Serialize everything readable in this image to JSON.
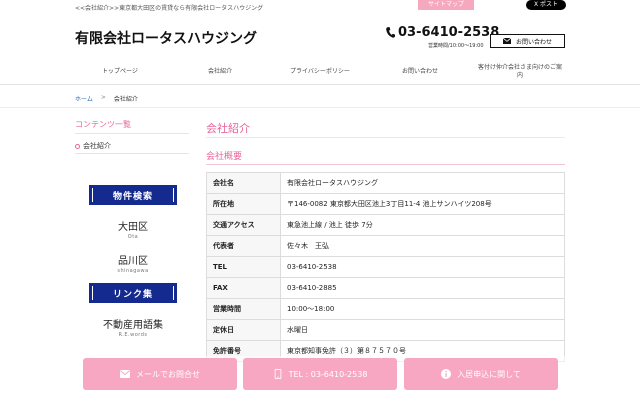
{
  "header": {
    "tagline": "<<会社紹介>>東京都大田区の賃貸なら有限会社ロータスハウジング",
    "sitemap_label": "サイトマップ",
    "x_post_label": "X ポスト",
    "company_name": "有限会社ロータスハウジング",
    "phone": "03-6410-2538",
    "hours": "営業時間/10:00〜19:00",
    "contact_label": "お問い合わせ"
  },
  "nav": {
    "items": [
      {
        "label": "トップページ"
      },
      {
        "label": "会社紹介"
      },
      {
        "label": "プライバシーポリシー"
      },
      {
        "label": "お問い合わせ"
      },
      {
        "label": "客付け仲介会社さま向けのご案内"
      }
    ]
  },
  "breadcrumb": {
    "home": "ホーム",
    "separator": ">",
    "current": "会社紹介"
  },
  "sidebar": {
    "title": "コンテンツ一覧",
    "item": "会社紹介",
    "property_search": "物件検索",
    "areas": [
      {
        "jp": "大田区",
        "en": "Ota"
      },
      {
        "jp": "品川区",
        "en": "shinagawa"
      }
    ],
    "links_title": "リンク集",
    "links": [
      {
        "jp": "不動産用語集",
        "en": "R.E.words"
      }
    ]
  },
  "main": {
    "title": "会社紹介",
    "subtitle": "会社概要",
    "rows": [
      {
        "key": "会社名",
        "value": "有限会社ロータスハウジング"
      },
      {
        "key": "所在地",
        "value": "〒146-0082 東京都大田区池上3丁目11-4 池上サンハイツ208号"
      },
      {
        "key": "交通アクセス",
        "value": "東急池上線 / 池上 徒歩 7分"
      },
      {
        "key": "代表者",
        "value": "佐々木　王弘"
      },
      {
        "key": "TEL",
        "value": "03-6410-2538"
      },
      {
        "key": "FAX",
        "value": "03-6410-2885"
      },
      {
        "key": "営業時間",
        "value": "10:00〜18:00"
      },
      {
        "key": "定休日",
        "value": "水曜日"
      },
      {
        "key": "免許番号",
        "value": "東京都知事免許（３）第８７５７０号"
      }
    ]
  },
  "footer_buttons": {
    "mail": "メールでお問合せ",
    "tel": "TEL : 03-6410-2538",
    "apply": "入居申込に関して"
  },
  "colors": {
    "accent_pink": "#e8659a",
    "button_pink": "#f8a7c2",
    "banner_navy": "#142a8f"
  }
}
